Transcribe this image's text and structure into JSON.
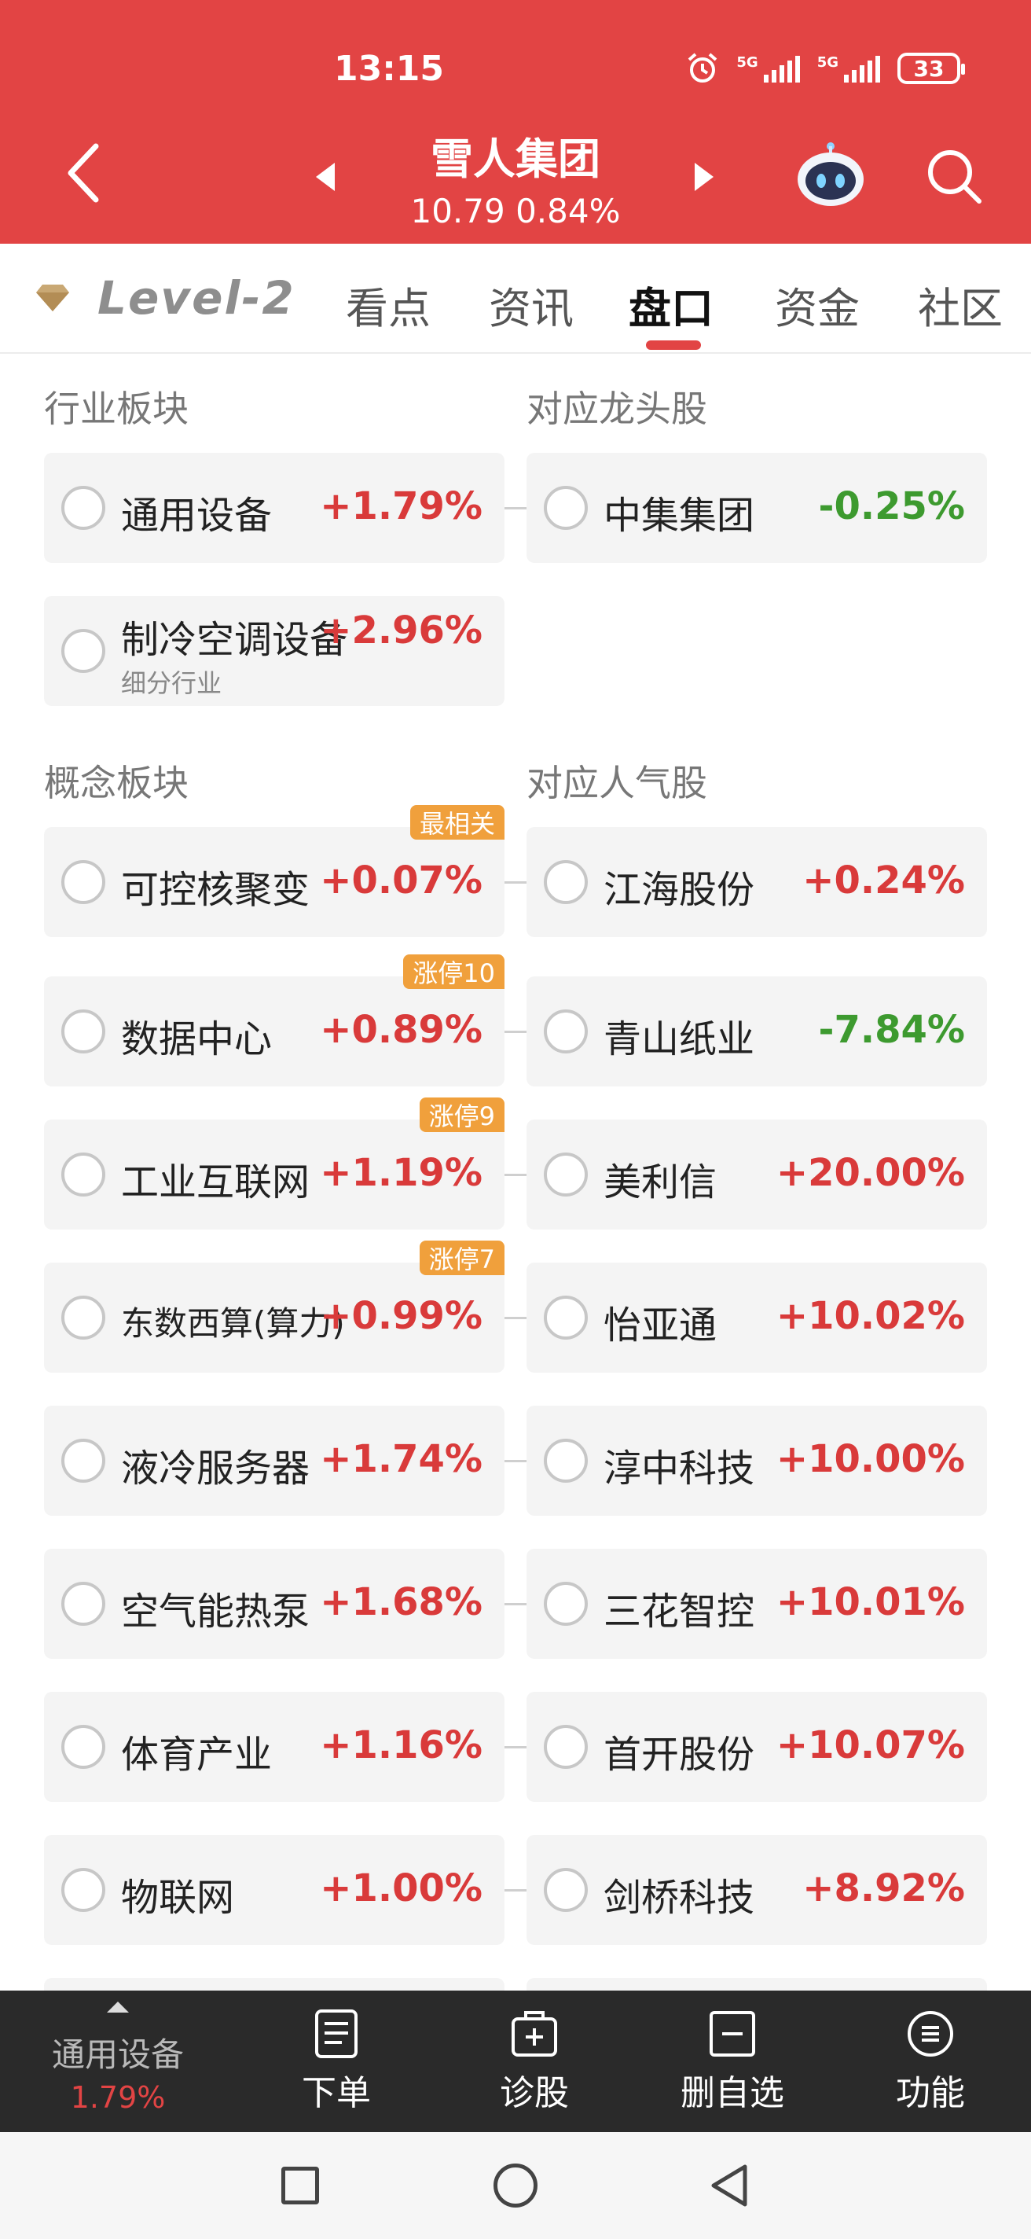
{
  "status_bar": {
    "time": "13:15",
    "network1": "5G",
    "network2": "5G",
    "battery": "33"
  },
  "header": {
    "stock_name": "雪人集团",
    "quote": "10.79 0.84%"
  },
  "tabs": {
    "level2_label": "Level-2",
    "items": [
      {
        "label": "看点"
      },
      {
        "label": "资讯"
      },
      {
        "label": "盘口"
      },
      {
        "label": "资金"
      },
      {
        "label": "社区"
      }
    ],
    "active": "盘口"
  },
  "sections": {
    "industry_title": "行业板块",
    "industry_leader_title": "对应龙头股",
    "concept_title": "概念板块",
    "concept_popular_title": "对应人气股"
  },
  "industry": [
    {
      "name": "通用设备",
      "pct": "+1.79%",
      "linked": {
        "name": "中集集团",
        "pct": "-0.25%"
      }
    },
    {
      "name": "制冷空调设备",
      "pct": "+2.96%",
      "sub": "细分行业"
    }
  ],
  "concepts": [
    {
      "name": "可控核聚变",
      "pct": "+0.07%",
      "badge": "最相关",
      "linked": {
        "name": "江海股份",
        "pct": "+0.24%"
      }
    },
    {
      "name": "数据中心",
      "pct": "+0.89%",
      "badge": "涨停10",
      "linked": {
        "name": "青山纸业",
        "pct": "-7.84%"
      }
    },
    {
      "name": "工业互联网",
      "pct": "+1.19%",
      "badge": "涨停9",
      "linked": {
        "name": "美利信",
        "pct": "+20.00%"
      }
    },
    {
      "name": "东数西算(算力)",
      "pct": "+0.99%",
      "badge": "涨停7",
      "linked": {
        "name": "怡亚通",
        "pct": "+10.02%"
      }
    },
    {
      "name": "液冷服务器",
      "pct": "+1.74%",
      "linked": {
        "name": "淳中科技",
        "pct": "+10.00%"
      }
    },
    {
      "name": "空气能热泵",
      "pct": "+1.68%",
      "linked": {
        "name": "三花智控",
        "pct": "+10.01%"
      }
    },
    {
      "name": "体育产业",
      "pct": "+1.16%",
      "linked": {
        "name": "首开股份",
        "pct": "+10.07%"
      }
    },
    {
      "name": "物联网",
      "pct": "+1.00%",
      "linked": {
        "name": "剑桥科技",
        "pct": "+8.92%"
      }
    }
  ],
  "bottom_bar": {
    "industry_name": "通用设备",
    "industry_pct": "1.79%",
    "items": [
      {
        "label": "下单",
        "icon": "order-icon"
      },
      {
        "label": "诊股",
        "icon": "diagnose-icon"
      },
      {
        "label": "删自选",
        "icon": "remove-watchlist-icon"
      },
      {
        "label": "功能",
        "icon": "menu-icon"
      }
    ]
  },
  "colors": {
    "brand_red": "#e24444",
    "up": "#d93a3a",
    "down": "#3d9a2f",
    "badge": "#f0a03c"
  }
}
